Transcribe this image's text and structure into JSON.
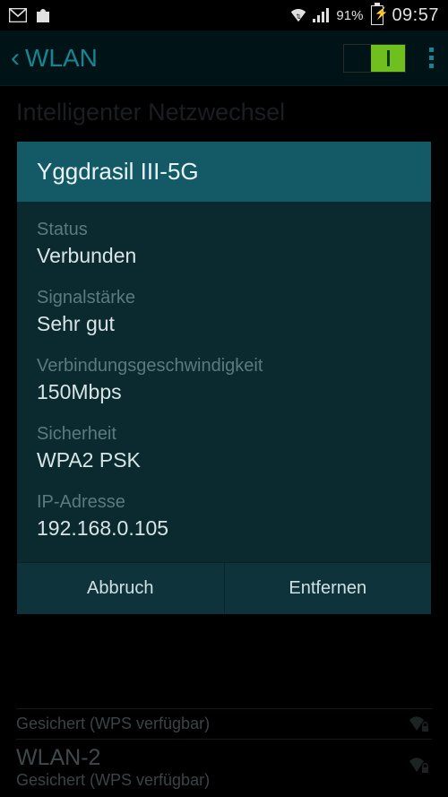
{
  "status_bar": {
    "battery_percent": "91%",
    "time": "09:57"
  },
  "action_bar": {
    "title": "WLAN"
  },
  "bg": {
    "heading": "Intelligenter Netzwechsel"
  },
  "dialog": {
    "title": "Yggdrasil III-5G",
    "fields": [
      {
        "label": "Status",
        "value": "Verbunden"
      },
      {
        "label": "Signalstärke",
        "value": "Sehr gut"
      },
      {
        "label": "Verbindungsgeschwindigkeit",
        "value": "150Mbps"
      },
      {
        "label": "Sicherheit",
        "value": "WPA2 PSK"
      },
      {
        "label": "IP-Adresse",
        "value": "192.168.0.105"
      }
    ],
    "buttons": {
      "cancel": "Abbruch",
      "forget": "Entfernen"
    }
  },
  "bottom": {
    "row0_sub": "Gesichert (WPS verfügbar)",
    "row1_ssid": "WLAN-2",
    "row1_sub": "Gesichert (WPS verfügbar)"
  }
}
